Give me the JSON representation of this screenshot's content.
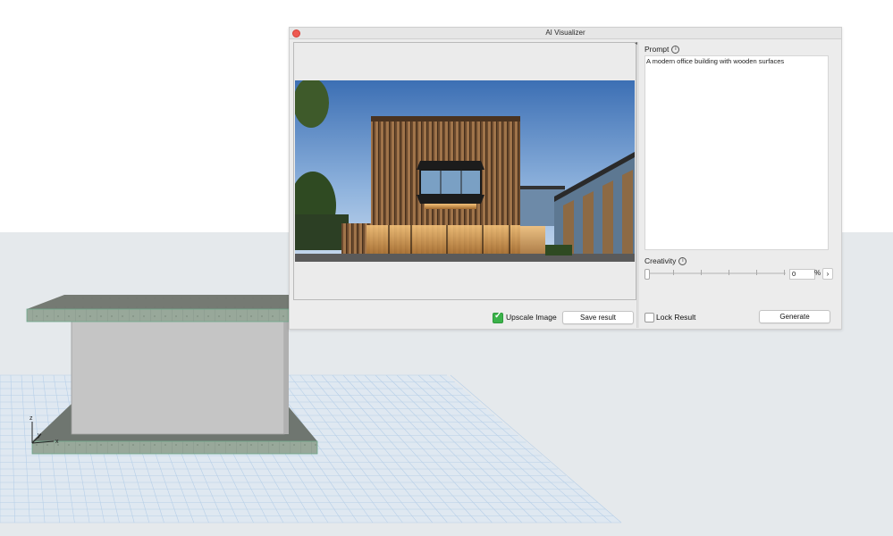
{
  "window": {
    "title": "AI Visualizer"
  },
  "prompt": {
    "label": "Prompt",
    "value": "A modern office building with wooden surfaces",
    "info_icon": "info-icon"
  },
  "creativity": {
    "label": "Creativity",
    "value": "0",
    "unit": "%",
    "slider_fraction": 0,
    "info_icon": "info-icon"
  },
  "options": {
    "upscale_label": "Upscale Image",
    "upscale_checked": true,
    "lock_label": "Lock Result",
    "lock_checked": false
  },
  "buttons": {
    "save_label": "Save result",
    "generate_label": "Generate",
    "stepper_symbol": "›"
  },
  "axes": {
    "z": "z",
    "y": "y",
    "x": "x"
  },
  "colors": {
    "checkbox_green": "#3bb24a",
    "close_red": "#ee5a52",
    "grid_blue": "#b7cfe8",
    "slab_green": "#8ea08e"
  }
}
